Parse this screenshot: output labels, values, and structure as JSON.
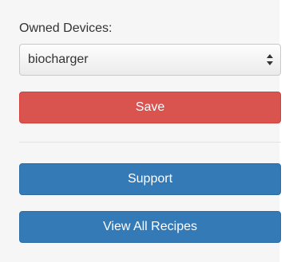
{
  "form": {
    "owned_devices_label": "Owned Devices:",
    "owned_devices_selected": "biocharger",
    "save_label": "Save",
    "support_label": "Support",
    "view_all_recipes_label": "View All Recipes"
  },
  "icons": {
    "select_arrows": "select-arrows-icon"
  },
  "colors": {
    "panel_bg": "#f6f6f6",
    "danger": "#d9534f",
    "primary": "#337ab7",
    "text": "#333333"
  }
}
